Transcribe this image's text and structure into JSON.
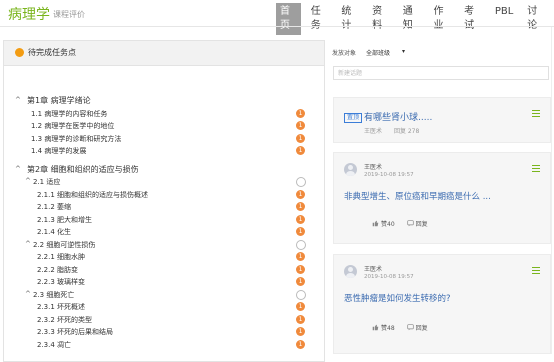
{
  "header": {
    "brand": "病理学",
    "subtitle": "课程评价",
    "nav": [
      {
        "label": "首页",
        "active": true
      },
      {
        "label": "任务",
        "active": false
      },
      {
        "label": "统计",
        "active": false
      },
      {
        "label": "资料",
        "active": false
      },
      {
        "label": "通知",
        "active": false
      },
      {
        "label": "作业",
        "active": false
      },
      {
        "label": "考试",
        "active": false
      },
      {
        "label": "PBL",
        "active": false
      },
      {
        "label": "讨论",
        "active": false
      }
    ]
  },
  "tasks": {
    "title": "待完成任务点",
    "rows": [
      {
        "level": 0,
        "arrow": "^",
        "label": "第1章 病理学绪论",
        "badge": ""
      },
      {
        "level": 1,
        "arrow": "",
        "label": "1.1  病理学的内容和任务",
        "badge": "1"
      },
      {
        "level": 1,
        "arrow": "",
        "label": "1.2  病理学在医学中的地位",
        "badge": "1"
      },
      {
        "level": 1,
        "arrow": "",
        "label": "1.3  病理学的诊断和研究方法",
        "badge": "1"
      },
      {
        "level": 1,
        "arrow": "",
        "label": "1.4  病理学的发展",
        "badge": "1"
      },
      {
        "level": -1,
        "arrow": "",
        "label": "",
        "badge": ""
      },
      {
        "level": 0,
        "arrow": "^",
        "label": "第2章 细胞和组织的适应与损伤",
        "badge": ""
      },
      {
        "level": 1,
        "arrow": "^",
        "label": "2.1  适应",
        "badge": "empty"
      },
      {
        "level": 2,
        "arrow": "",
        "label": "2.1.1  细胞和组织的适应与损伤概述",
        "badge": "1"
      },
      {
        "level": 2,
        "arrow": "",
        "label": "2.1.2  萎缩",
        "badge": "1"
      },
      {
        "level": 2,
        "arrow": "",
        "label": "2.1.3  肥大和增生",
        "badge": "1"
      },
      {
        "level": 2,
        "arrow": "",
        "label": "2.1.4  化生",
        "badge": "1"
      },
      {
        "level": 1,
        "arrow": "^",
        "label": "2.2  细胞可逆性损伤",
        "badge": "empty"
      },
      {
        "level": 2,
        "arrow": "",
        "label": "2.2.1  细胞水肿",
        "badge": "1"
      },
      {
        "level": 2,
        "arrow": "",
        "label": "2.2.2  脂肪变",
        "badge": "1"
      },
      {
        "level": 2,
        "arrow": "",
        "label": "2.2.3  玻璃样变",
        "badge": "1"
      },
      {
        "level": 1,
        "arrow": "^",
        "label": "2.3  细胞死亡",
        "badge": "empty"
      },
      {
        "level": 2,
        "arrow": "",
        "label": "2.3.1  坏死概述",
        "badge": "1"
      },
      {
        "level": 2,
        "arrow": "",
        "label": "2.3.2  坏死的类型",
        "badge": "1"
      },
      {
        "level": 2,
        "arrow": "",
        "label": "2.3.3  坏死的后果和结局",
        "badge": "1"
      },
      {
        "level": 2,
        "arrow": "",
        "label": "2.3.4  凋亡",
        "badge": "1"
      }
    ]
  },
  "discussion": {
    "filter_label": "发放对象",
    "filter_value": "全部班级",
    "filter_caret": "▾",
    "search_placeholder": "新建话题",
    "pinned": {
      "tag": "置顶",
      "title": "有哪些肾小球.....",
      "author": "王医术",
      "replies": "回复 278"
    },
    "posts": [
      {
        "author": "王医术",
        "time": "2019-10-08 19:57",
        "question": "非典型增生、原位癌和早期癌是什么 ...",
        "likes": "赞40",
        "reply": "回复"
      },
      {
        "author": "王医术",
        "time": "2019-10-08 19:57",
        "question": "恶性肿瘤是如何发生转移的?",
        "likes": "赞48",
        "reply": "回复"
      }
    ],
    "colors": {
      "accent": "#7ab51d",
      "link": "#3b6bb0",
      "badge": "#f08a3c"
    }
  }
}
